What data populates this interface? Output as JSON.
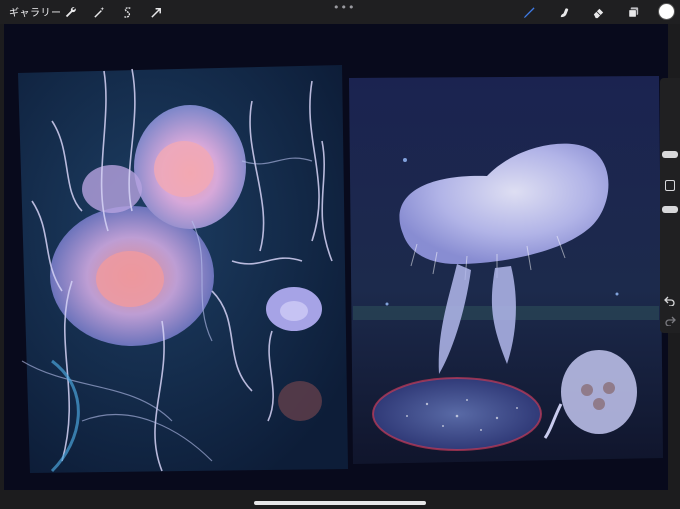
{
  "topbar": {
    "gallery_label": "ギャラリー",
    "left_tools": [
      "wrench-icon",
      "magic-wand-icon",
      "selection-icon",
      "transform-arrow-icon"
    ],
    "right_tools": [
      "brush-icon",
      "smudge-icon",
      "eraser-icon",
      "layers-icon"
    ],
    "more_dots": "•••",
    "active_tool": "brush",
    "accent_color": "#3f7be6",
    "current_color": "#ffffff"
  },
  "sidebar": {
    "controls": [
      "brush-size-slider",
      "modify-button",
      "opacity-slider",
      "undo-icon",
      "redo-icon"
    ]
  },
  "canvas": {
    "background": "#080a1c",
    "panels": [
      "jellyfish-painting-left",
      "jellyfish-painting-right"
    ]
  }
}
